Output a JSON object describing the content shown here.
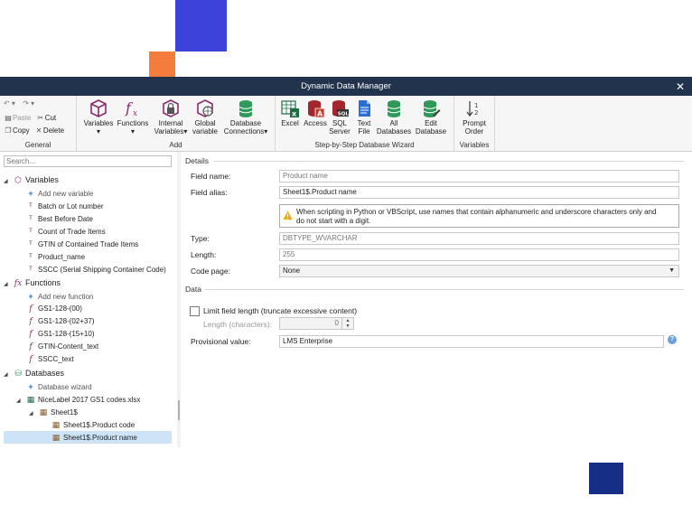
{
  "window": {
    "title": "Dynamic Data Manager",
    "close_glyph": "✕"
  },
  "ribbon": {
    "general": {
      "label": "General",
      "paste": "Paste",
      "cut": "Cut",
      "copy": "Copy",
      "delete": "Delete"
    },
    "add": {
      "label": "Add",
      "variables": "Variables",
      "functions": "Functions",
      "internal_variables_1": "Internal",
      "internal_variables_2": "Variables",
      "global_variable_1": "Global",
      "global_variable_2": "variable",
      "database_connections_1": "Database",
      "database_connections_2": "Connections"
    },
    "wizard": {
      "label": "Step-by-Step Database Wizard",
      "excel": "Excel",
      "access": "Access",
      "sql_server_1": "SQL",
      "sql_server_2": "Server",
      "text_file_1": "Text",
      "text_file_2": "File",
      "all_databases_1": "All",
      "all_databases_2": "Databases",
      "edit_database_1": "Edit",
      "edit_database_2": "Database"
    },
    "variables": {
      "label": "Variables",
      "prompt_order_1": "Prompt",
      "prompt_order_2": "Order"
    }
  },
  "search": {
    "placeholder": "Search..."
  },
  "tree": {
    "variables": {
      "header": "Variables",
      "add": "Add new variable",
      "items": [
        "Batch or Lot number",
        "Best Before Date",
        "Count of Trade Items",
        "GTIN of Contained Trade Items",
        "Product_name",
        "SSCC (Serial Shipping Container Code)"
      ]
    },
    "functions": {
      "header": "Functions",
      "add": "Add new function",
      "items": [
        "GS1-128-(00)",
        "GS1-128-(02+37)",
        "GS1-128-(15+10)",
        "GTIN-Content_text",
        "SSCC_text"
      ]
    },
    "databases": {
      "header": "Databases",
      "wizard": "Database wizard",
      "file": "NiceLabel 2017 GS1 codes.xlsx",
      "table": "Sheet1$",
      "fields": [
        "Sheet1$.Product code",
        "Sheet1$.Product name"
      ]
    }
  },
  "details": {
    "section": "Details",
    "field_name_label": "Field name:",
    "field_name": "Product name",
    "field_alias_label": "Field alias:",
    "field_alias": "Sheet1$.Product name",
    "warning_1": "When scripting in Python or VBScript, use names that contain alphanumeric and underscore characters only and",
    "warning_2": "do not start with a digit.",
    "type_label": "Type:",
    "type": "DBTYPE_WVARCHAR",
    "length_label": "Length:",
    "length": "255",
    "code_page_label": "Code page:",
    "code_page": "None"
  },
  "data": {
    "section": "Data",
    "limit_label": "Limit field length (truncate excessive content)",
    "limit_checked": false,
    "length_chars_label": "Length (characters):",
    "length_chars": "0",
    "provisional_label": "Provisional value:",
    "provisional": "LMS Enterprise"
  },
  "colors": {
    "titlebar": "#21334d",
    "selection": "#cde4f7",
    "accent_blue": "#3d43d8",
    "accent_orange": "#f47c3c",
    "accent_navy": "#162e86"
  }
}
